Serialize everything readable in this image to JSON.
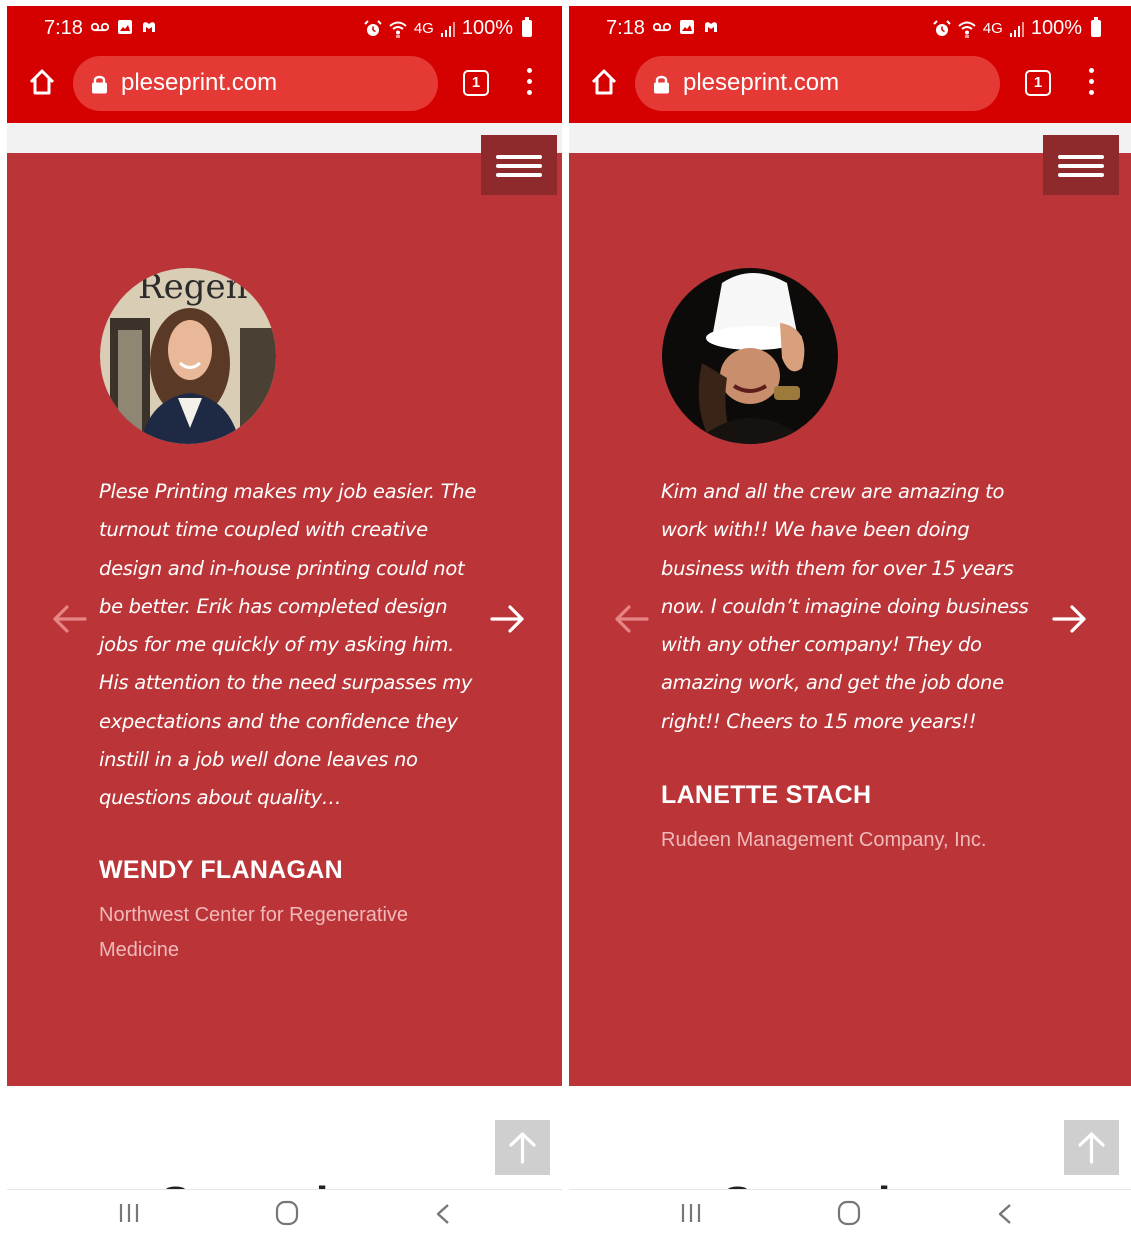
{
  "screens": [
    {
      "status": {
        "time": "7:18",
        "battery": "100%",
        "network": "4G"
      },
      "browser": {
        "url": "pleseprint.com",
        "tab_count": "1"
      },
      "testimonial": {
        "quote": "Plese Printing makes my job easier. The turnout time coupled with creative design and in-house printing could not be better. Erik has completed design jobs for me quickly of my asking him. His attention to the need surpasses my expectations and the confidence they instill in a job well done leaves no questions about quality…",
        "name": "WENDY FLANAGAN",
        "company": "Northwest Center for Regenerative Medicine",
        "avatar_caption": "Regen"
      },
      "partial_heading": "Servi"
    },
    {
      "status": {
        "time": "7:18",
        "battery": "100%",
        "network": "4G"
      },
      "browser": {
        "url": "pleseprint.com",
        "tab_count": "1"
      },
      "testimonial": {
        "quote": "Kim and all the crew are amazing to work with!! We have been doing business with them for over 15 years now. I couldn’t imagine doing business with any other company! They do amazing work, and get the job done right!! Cheers to 15 more years!!",
        "name": "LANETTE STACH",
        "company": "Rudeen Management Company, Inc.",
        "avatar_caption": ""
      },
      "partial_heading": "Servi"
    }
  ],
  "icons": {
    "home": "home-icon",
    "lock": "lock-icon",
    "tabs": "tab-switcher-icon",
    "menu": "hamburger-menu-icon",
    "prev": "arrow-left-icon",
    "next": "arrow-right-icon",
    "scroll_top": "arrow-up-icon",
    "nav_recent": "recent-apps-icon",
    "nav_home": "nav-home-icon",
    "nav_back": "nav-back-icon"
  },
  "colors": {
    "chrome_red": "#d50000",
    "section_red": "#bb3538",
    "menu_btn": "#8e2a2c",
    "company_text": "#f0b9ba"
  }
}
